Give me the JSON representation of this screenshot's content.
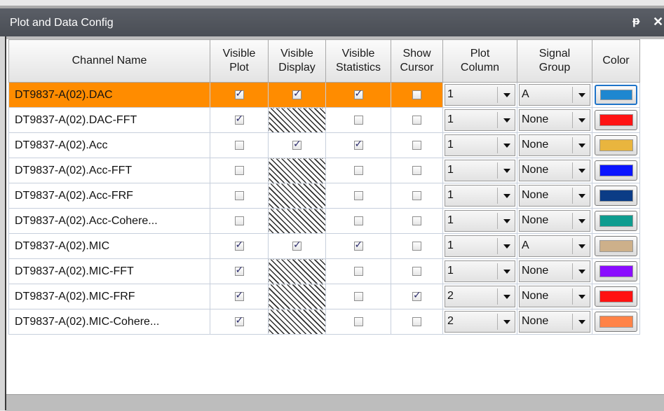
{
  "window": {
    "title": "Plot and Data Config",
    "pin_icon": "pin-icon",
    "close_icon": "close-icon"
  },
  "columns": {
    "channel_name": "Channel Name",
    "visible_plot": [
      "Visible",
      "Plot"
    ],
    "visible_display": [
      "Visible",
      "Display"
    ],
    "visible_statistics": [
      "Visible",
      "Statistics"
    ],
    "show_cursor": [
      "Show",
      "Cursor"
    ],
    "plot_column": [
      "Plot",
      "Column"
    ],
    "signal_group": [
      "Signal",
      "Group"
    ],
    "color": "Color"
  },
  "rows": [
    {
      "name": "DT9837-A(02).DAC",
      "plot": true,
      "display": true,
      "statistics": true,
      "cursor": false,
      "plot_column": "1",
      "signal_group": "A",
      "color": "#1e87d0",
      "selected": true,
      "display_hatched": false
    },
    {
      "name": "DT9837-A(02).DAC-FFT",
      "plot": true,
      "display": false,
      "statistics": false,
      "cursor": false,
      "plot_column": "1",
      "signal_group": "None",
      "color": "#ff1313",
      "selected": false,
      "display_hatched": true
    },
    {
      "name": "DT9837-A(02).Acc",
      "plot": false,
      "display": true,
      "statistics": true,
      "cursor": false,
      "plot_column": "1",
      "signal_group": "None",
      "color": "#e9b53e",
      "selected": false,
      "display_hatched": false
    },
    {
      "name": "DT9837-A(02).Acc-FFT",
      "plot": false,
      "display": false,
      "statistics": false,
      "cursor": false,
      "plot_column": "1",
      "signal_group": "None",
      "color": "#0a14ff",
      "selected": false,
      "display_hatched": true
    },
    {
      "name": "DT9837-A(02).Acc-FRF",
      "plot": false,
      "display": false,
      "statistics": false,
      "cursor": false,
      "plot_column": "1",
      "signal_group": "None",
      "color": "#0b3c86",
      "selected": false,
      "display_hatched": true
    },
    {
      "name": "DT9837-A(02).Acc-Cohere...",
      "plot": false,
      "display": false,
      "statistics": false,
      "cursor": false,
      "plot_column": "1",
      "signal_group": "None",
      "color": "#0e9c8f",
      "selected": false,
      "display_hatched": true
    },
    {
      "name": "DT9837-A(02).MIC",
      "plot": true,
      "display": true,
      "statistics": true,
      "cursor": false,
      "plot_column": "1",
      "signal_group": "A",
      "color": "#cdb08a",
      "selected": false,
      "display_hatched": false
    },
    {
      "name": "DT9837-A(02).MIC-FFT",
      "plot": true,
      "display": false,
      "statistics": false,
      "cursor": false,
      "plot_column": "1",
      "signal_group": "None",
      "color": "#8a0cff",
      "selected": false,
      "display_hatched": true
    },
    {
      "name": "DT9837-A(02).MIC-FRF",
      "plot": true,
      "display": false,
      "statistics": false,
      "cursor": true,
      "plot_column": "2",
      "signal_group": "None",
      "color": "#ff1212",
      "selected": false,
      "display_hatched": true
    },
    {
      "name": "DT9837-A(02).MIC-Cohere...",
      "plot": true,
      "display": false,
      "statistics": false,
      "cursor": false,
      "plot_column": "2",
      "signal_group": "None",
      "color": "#ff8347",
      "selected": false,
      "display_hatched": true
    }
  ]
}
